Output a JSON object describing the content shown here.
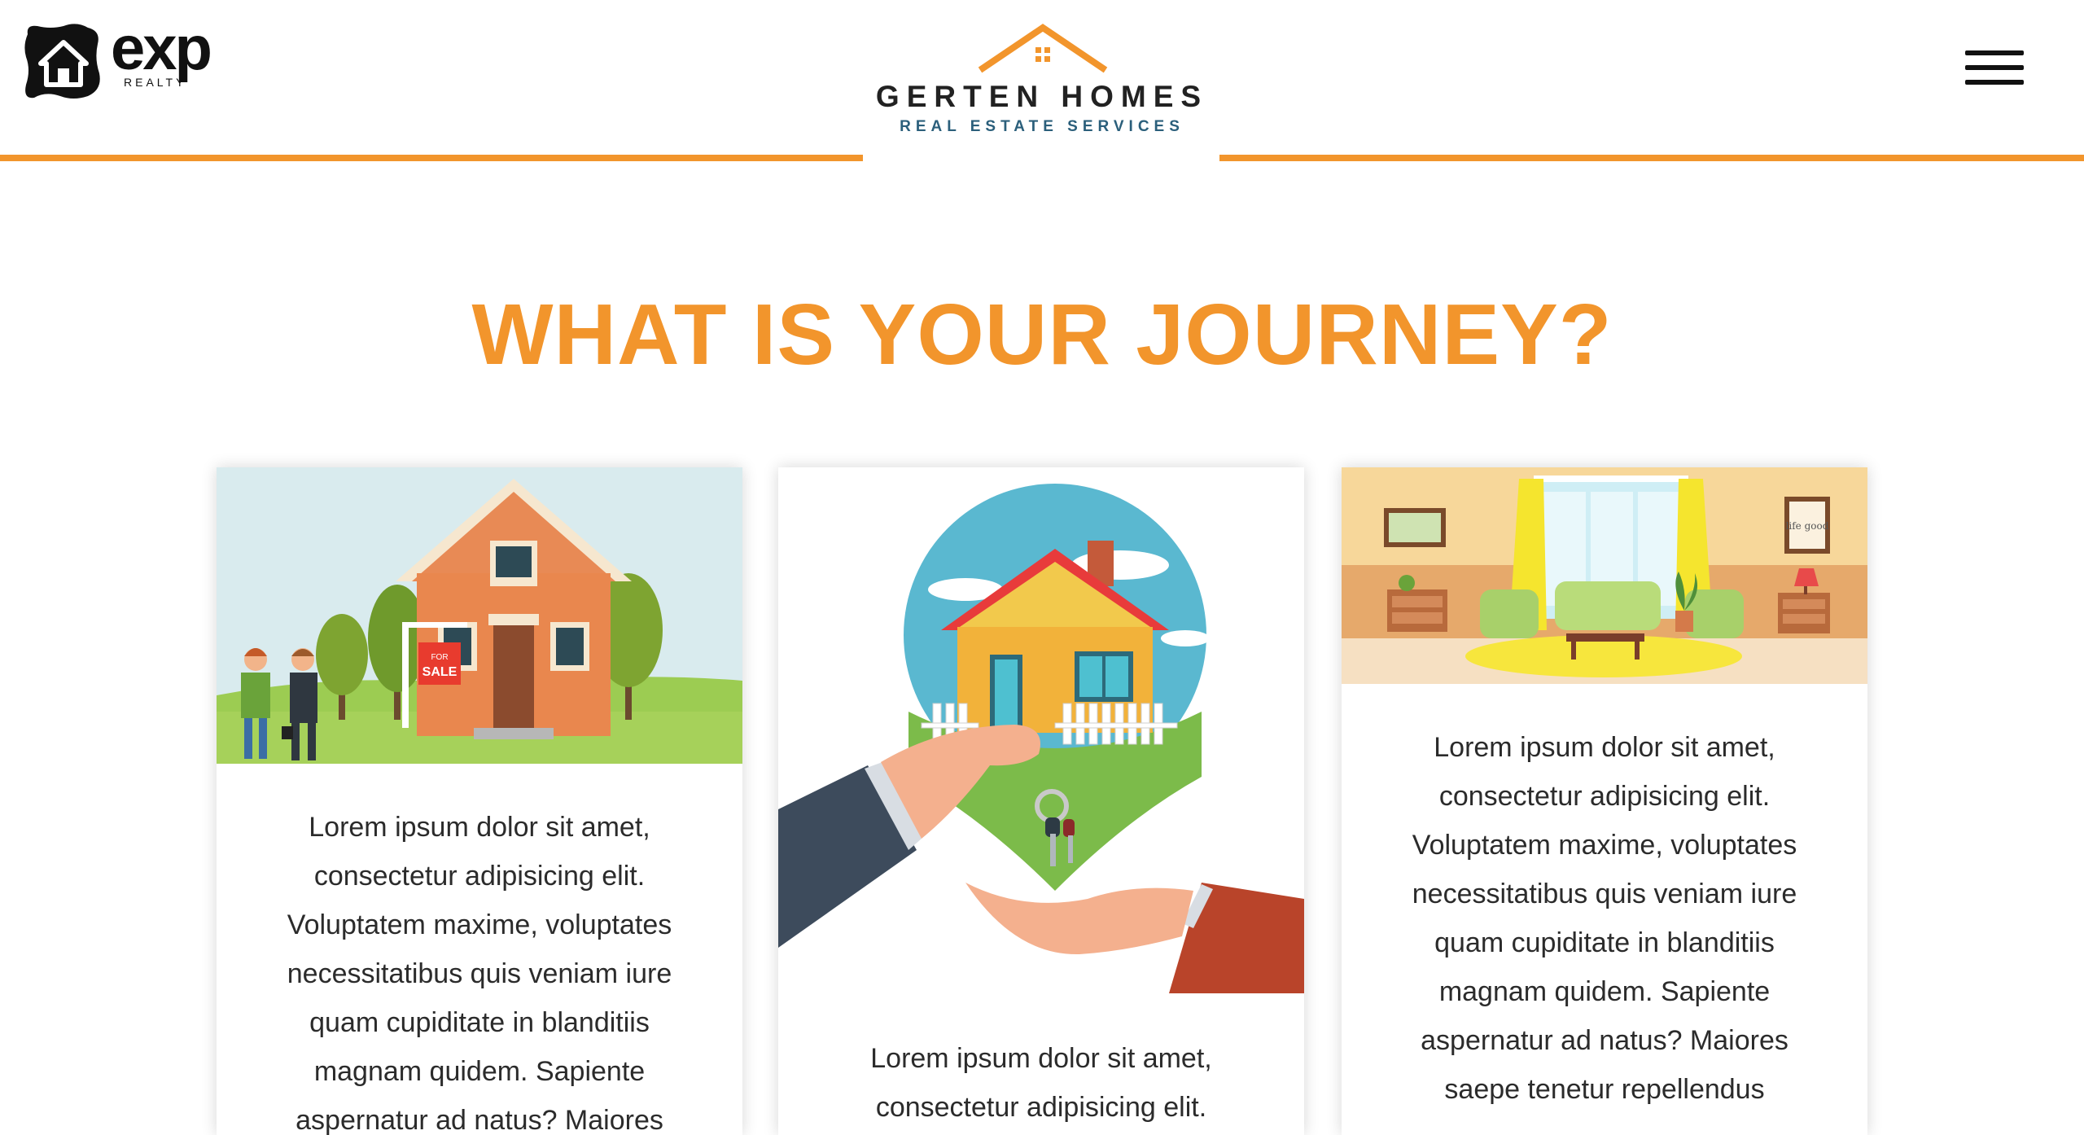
{
  "header": {
    "left_logo": {
      "word": "exp",
      "sub": "REALTY",
      "icon": "house-icon"
    },
    "brand": {
      "name": "GERTEN HOMES",
      "tagline": "REAL ESTATE SERVICES",
      "icon": "roof-icon"
    },
    "menu_icon": "hamburger-menu-icon"
  },
  "colors": {
    "accent": "#f2952c",
    "tagline": "#2b5f7b",
    "text": "#2b2b2b"
  },
  "section": {
    "title": "WHAT IS YOUR JOURNEY?"
  },
  "cards": [
    {
      "illustration": "house-for-sale-illustration",
      "sign_top": "FOR",
      "sign_bottom": "SALE",
      "text": "Lorem ipsum dolor sit amet, consectetur adipisicing elit. Voluptatem maxime, voluptates necessitatibus quis veniam iure quam cupiditate in blanditiis magnam quidem. Sapiente aspernatur ad natus? Maiores"
    },
    {
      "illustration": "house-keys-handover-illustration",
      "text": "Lorem ipsum dolor sit amet, consectetur adipisicing elit."
    },
    {
      "illustration": "living-room-illustration",
      "frame_text": "life good",
      "text": "Lorem ipsum dolor sit amet, consectetur adipisicing elit. Voluptatem maxime, voluptates necessitatibus quis veniam iure quam cupiditate in blanditiis magnam quidem. Sapiente aspernatur ad natus? Maiores saepe tenetur repellendus"
    }
  ]
}
